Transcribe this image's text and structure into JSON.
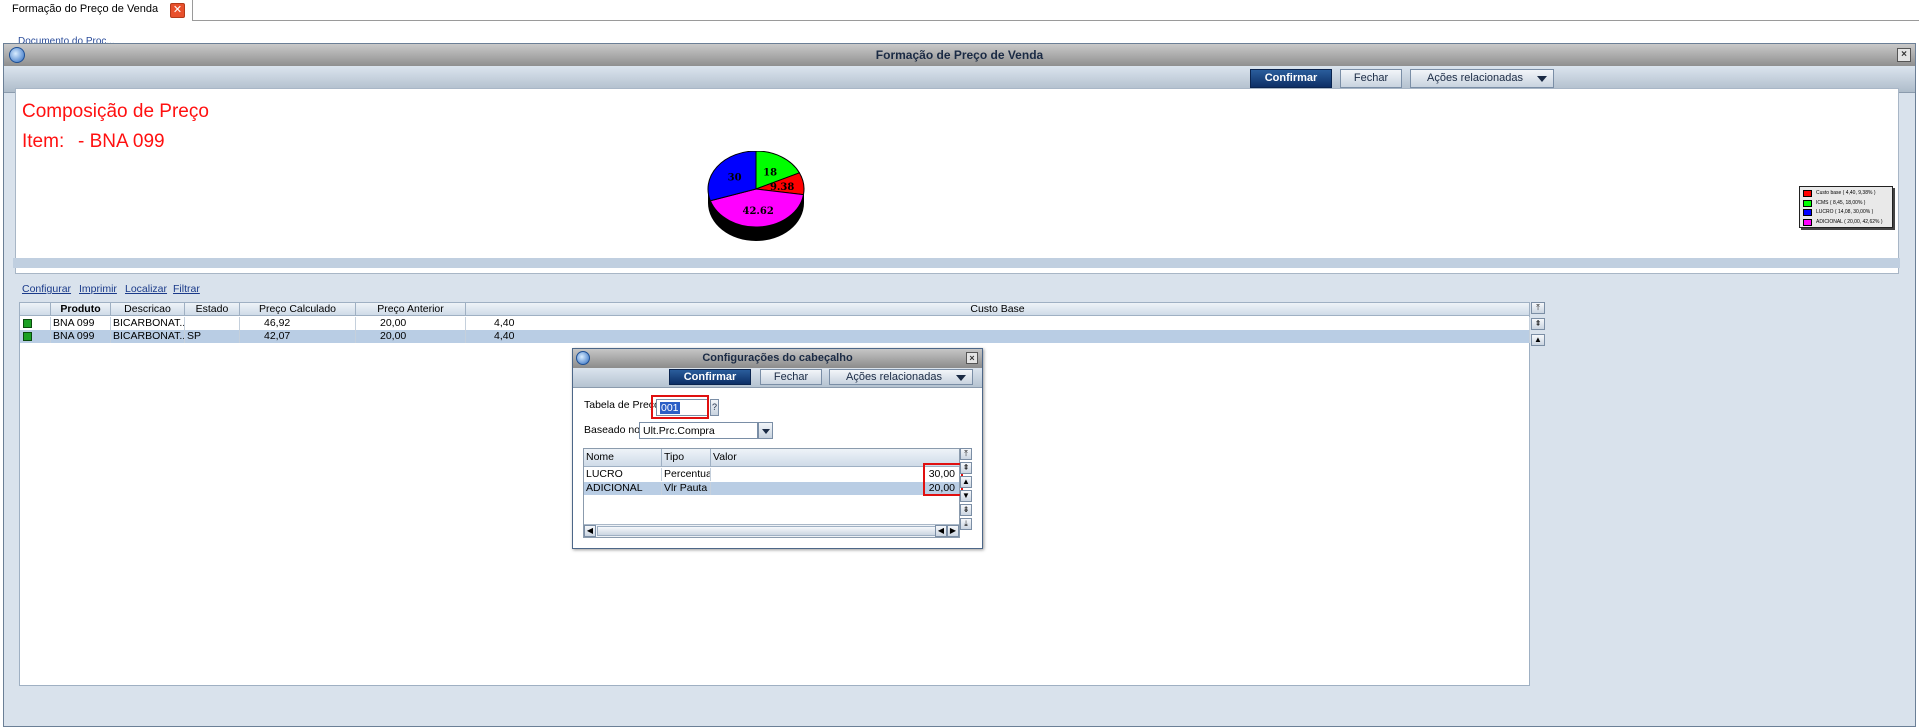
{
  "tab": {
    "label": "Formação do Preço de Venda",
    "close_symbol": "✕"
  },
  "behind_text": "Documento do Proc...",
  "window": {
    "title": "Formação de Preço de Venda",
    "close_symbol": "×",
    "toolbar": {
      "confirm": "Confirmar",
      "close": "Fechar",
      "actions": "Ações relacionadas"
    }
  },
  "chart_panel": {
    "title": "Composição de Preço",
    "item_label": "Item:",
    "item_value": "- BNA 099"
  },
  "chart_data": {
    "type": "pie",
    "title": "",
    "slices": [
      {
        "label": "Custo base ( 4,40,  9,38% )",
        "value": 9.38,
        "color": "#ff0000"
      },
      {
        "label": "ICMS     ( 8,45, 18,00% )",
        "value": 18,
        "color": "#00ff00"
      },
      {
        "label": "LUCRO    ( 14,08, 30,00% )",
        "value": 30,
        "color": "#0000ff"
      },
      {
        "label": "ADICIONAL ( 20,00, 42,62% )",
        "value": 42.62,
        "color": "#ff00ff"
      }
    ],
    "data_labels": [
      "9.38",
      "18",
      "30",
      "42.62"
    ],
    "legend_position": "right"
  },
  "links": [
    "Configurar",
    "Imprimir",
    "Localizar",
    "Filtrar"
  ],
  "grid": {
    "columns": [
      "",
      "Produto",
      "Descricao",
      "Estado",
      "Preço Calculado",
      "Preço Anterior",
      "Custo Base"
    ],
    "rows": [
      [
        "",
        "BNA 099",
        "BICARBONAT...",
        "",
        "46,92",
        "20,00",
        "4,40"
      ],
      [
        "",
        "BNA 099",
        "BICARBONAT...",
        "SP",
        "42,07",
        "20,00",
        "4,40"
      ]
    ],
    "status_color": "#1ca023"
  },
  "dialog": {
    "title": "Configurações do cabeçalho",
    "close_symbol": "×",
    "toolbar": {
      "confirm": "Confirmar",
      "close": "Fechar",
      "actions": "Ações relacionadas"
    },
    "tabela_label": "Tabela de Preço",
    "tabela_value": "001",
    "lookup_symbol": "?",
    "baseado_label": "Baseado no",
    "baseado_value": "Ult.Prc.Compra",
    "columns": [
      "Nome",
      "Tipo",
      "Valor"
    ],
    "rows": [
      [
        "LUCRO",
        "Percentual",
        "30,00"
      ],
      [
        "ADICIONAL",
        "Vlr Pauta",
        "20,00"
      ]
    ]
  }
}
